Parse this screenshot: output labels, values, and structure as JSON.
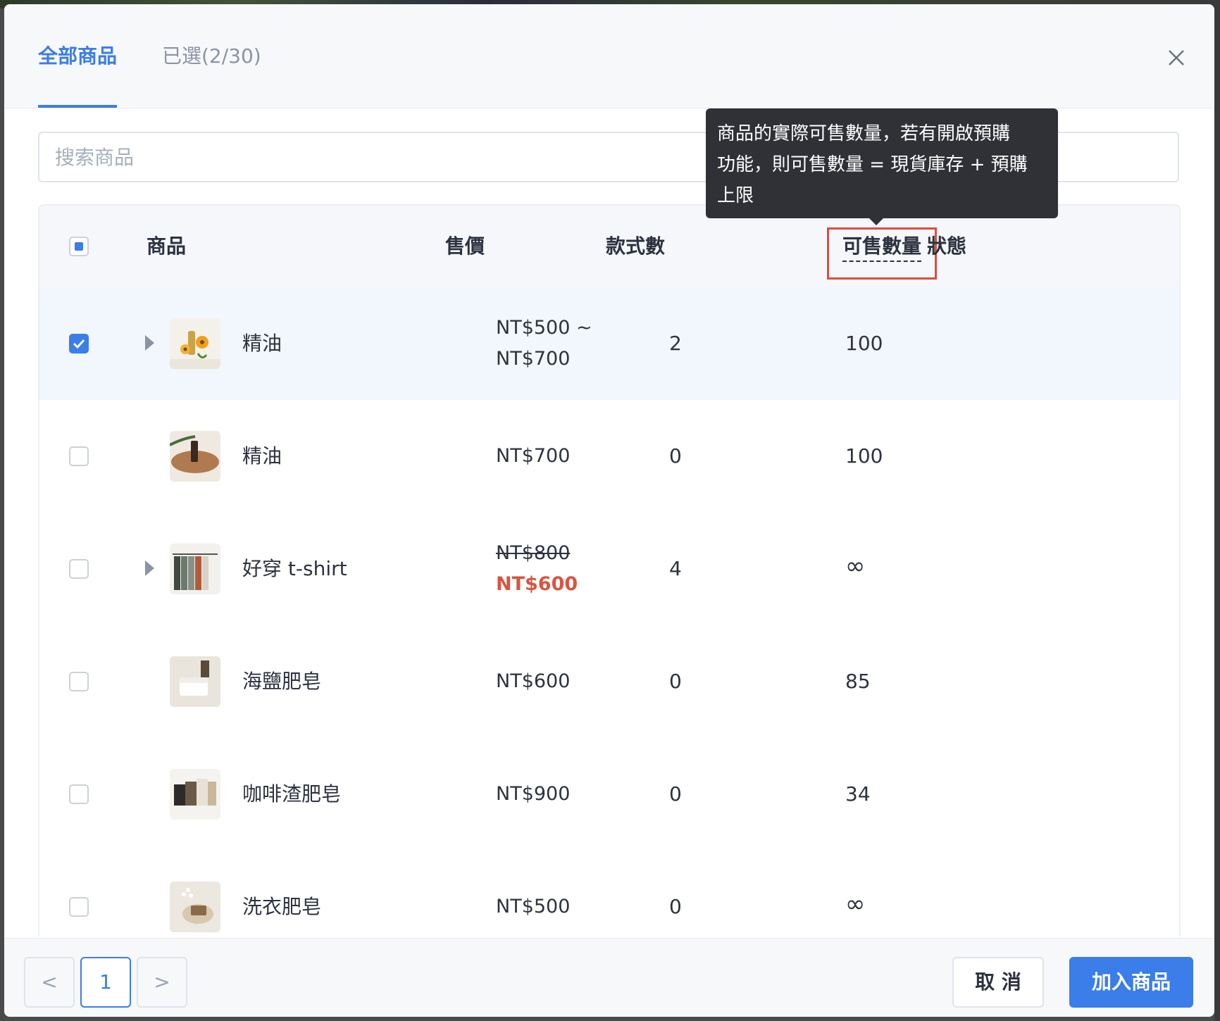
{
  "tabs": {
    "all_products": "全部商品",
    "selected": "已選(2/30)"
  },
  "close_icon": "close-x",
  "search": {
    "placeholder": "搜索商品",
    "value": ""
  },
  "table": {
    "headers": {
      "product": "商品",
      "price": "售價",
      "variants": "款式數",
      "sellable_qty": "可售數量",
      "status": "狀態"
    },
    "rows": [
      {
        "name": "精油",
        "price_line1": "NT$500 ~",
        "price_line2": "NT$700",
        "variants": "2",
        "qty": "100",
        "checked": true,
        "expandable": true
      },
      {
        "name": "精油",
        "price": "NT$700",
        "variants": "0",
        "qty": "100",
        "checked": false,
        "expandable": false
      },
      {
        "name": "好穿 t-shirt",
        "price_original": "NT$800",
        "price_sale": "NT$600",
        "variants": "4",
        "qty": "∞",
        "checked": false,
        "expandable": true
      },
      {
        "name": "海鹽肥皂",
        "price": "NT$600",
        "variants": "0",
        "qty": "85",
        "checked": false,
        "expandable": false
      },
      {
        "name": "咖啡渣肥皂",
        "price": "NT$900",
        "variants": "0",
        "qty": "34",
        "checked": false,
        "expandable": false
      },
      {
        "name": "洗衣肥皂",
        "price": "NT$500",
        "variants": "0",
        "qty": "∞",
        "checked": false,
        "expandable": false
      }
    ]
  },
  "tooltip": {
    "line1": "商品的實際可售數量，若有開啟預購",
    "line2": "功能，則可售數量 = 現貨庫存 + 預購",
    "line3": "上限"
  },
  "pagination": {
    "prev": "<",
    "current": "1",
    "next": ">"
  },
  "footer": {
    "cancel": "取 消",
    "add": "加入商品"
  },
  "colors": {
    "accent": "#3b7de9",
    "sale": "#d9553f",
    "highlight_box": "#e04b3c"
  }
}
